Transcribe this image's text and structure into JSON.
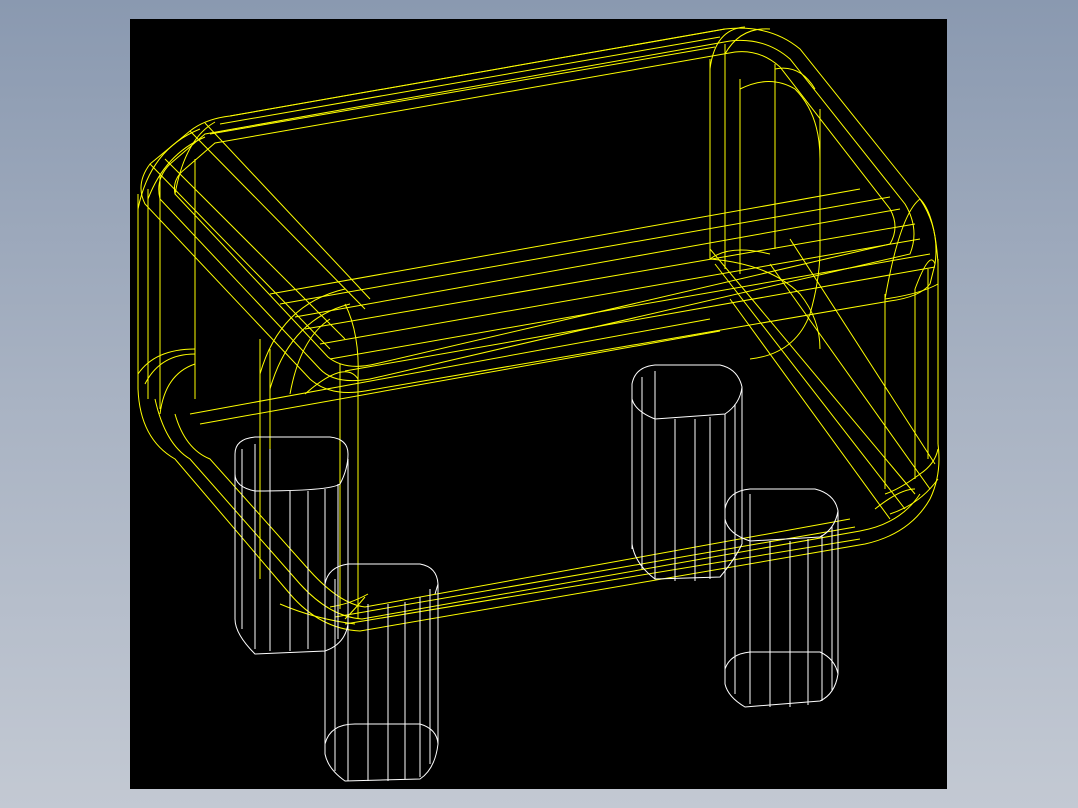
{
  "colors": {
    "background_top": "#8a99b0",
    "background_bottom": "#c3c9d3",
    "viewport": "#000000",
    "body_wire": "#ffff00",
    "pin_wire": "#ffffff"
  },
  "model": {
    "body": {
      "style": "wireframe",
      "color_name": "yellow"
    },
    "pins": {
      "count": 4,
      "style": "wireframe",
      "color_name": "white"
    }
  }
}
